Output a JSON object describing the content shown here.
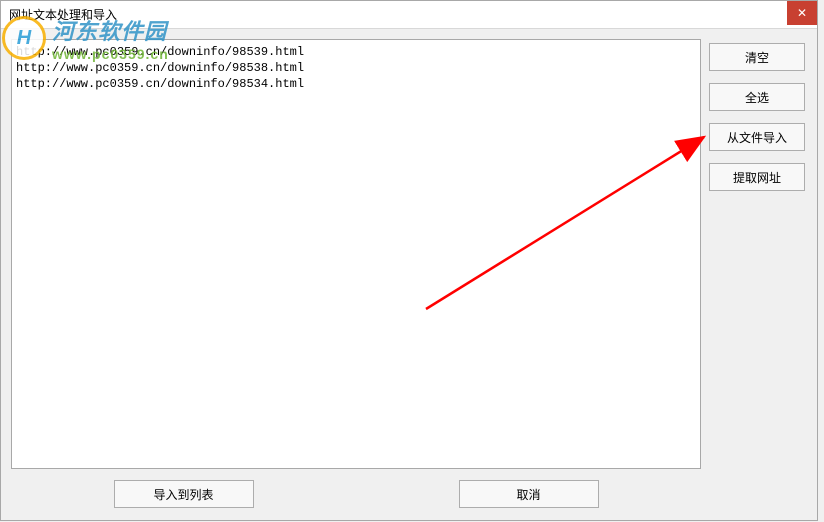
{
  "window": {
    "title": "网址文本处理和导入"
  },
  "textarea": {
    "content": "http://www.pc0359.cn/downinfo/98539.html\nhttp://www.pc0359.cn/downinfo/98538.html\nhttp://www.pc0359.cn/downinfo/98534.html"
  },
  "side_buttons": {
    "clear": "清空",
    "select_all": "全选",
    "import_from_file": "从文件导入",
    "extract_url": "提取网址"
  },
  "bottom_buttons": {
    "import_to_list": "导入到列表",
    "cancel": "取消"
  },
  "watermark": {
    "main": "河东软件园",
    "sub": "www.pc0359.cn",
    "icon": "H"
  }
}
